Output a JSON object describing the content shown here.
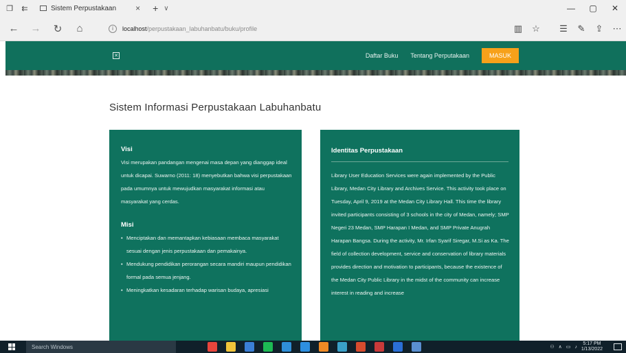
{
  "browser": {
    "tab_title": "Sistem Perpustakaan",
    "tab_close": "×",
    "new_tab": "+",
    "tab_chevron": "∨",
    "url_host": "localhost",
    "url_path": "/perpustakaan_labuhanbatu/buku/profile",
    "win_minimize": "—",
    "win_restore": "▢",
    "win_close": "✕"
  },
  "site": {
    "nav": [
      {
        "label": "Daftar Buku"
      },
      {
        "label": "Tentang Perputakaan"
      }
    ],
    "login_label": "MASUK",
    "colors": {
      "header": "#10705c",
      "accent": "#f7a11a",
      "card": "#0f725e"
    }
  },
  "page": {
    "title": "Sistem Informasi Perpustakaan Labuhanbatu",
    "visi_heading": "Visi",
    "visi_text": "Visi merupakan pandangan mengenai masa depan yang dianggap ideal untuk dicapai. Suwarno (2011: 18) menyebutkan bahwa visi perpustakaan pada umumnya untuk mewujudkan masyarakat informasi atau masyarakat yang cerdas.",
    "misi_heading": "Misi",
    "misi_items": [
      "Menciptakan dan memantapkan kebiasaan membaca masyarakat sesuai dengan jenis perpustakaan dan pemakainya.",
      "Mendukung pendidikan perorangan secara mandiri maupun pendidikan formal pada semua jenjang.",
      "Meningkatkan kesadaran terhadap warisan budaya, apresiasi"
    ],
    "identitas_heading": "Identitas Perpustakaan",
    "identitas_text": "Library User Education Services were again implemented by the Public Library, Medan City Library and Archives Service. This activity took place on Tuesday, April 9, 2019 at the Medan City Library Hall. This time the library invited participants consisting of 3 schools in the city of Medan, namely; SMP Negeri 23 Medan, SMP Harapan I Medan, and SMP Private Anugrah Harapan Bangsa. During the activity, Mr. Irfan Syarif Siregar, M.Si as Ka. The field of collection development, service and conservation of library materials provides direction and motivation to participants, because the existence of the Medan City Public Library in the midst of the community can increase interest in reading and increase"
  },
  "taskbar": {
    "search_placeholder": "Search Windows",
    "time": "5:17 PM",
    "date": "1/13/2022",
    "apps": [
      {
        "icon": "chrome-icon",
        "color": "#e8453c"
      },
      {
        "icon": "file-manager-icon",
        "color": "#f0c43a"
      },
      {
        "icon": "browser-icon",
        "color": "#3b7fd6"
      },
      {
        "icon": "spotify-icon",
        "color": "#1db954"
      },
      {
        "icon": "edge-icon",
        "color": "#2f8fd8"
      },
      {
        "icon": "vscode-icon",
        "color": "#2d8fe0"
      },
      {
        "icon": "sublime-icon",
        "color": "#f08a24"
      },
      {
        "icon": "app-icon",
        "color": "#3aa0c8"
      },
      {
        "icon": "office-icon",
        "color": "#d64b2e"
      },
      {
        "icon": "game-icon",
        "color": "#c83a3a"
      },
      {
        "icon": "blue-app-icon",
        "color": "#2b6fd6"
      },
      {
        "icon": "photos-icon",
        "color": "#5a8fd0"
      }
    ]
  }
}
